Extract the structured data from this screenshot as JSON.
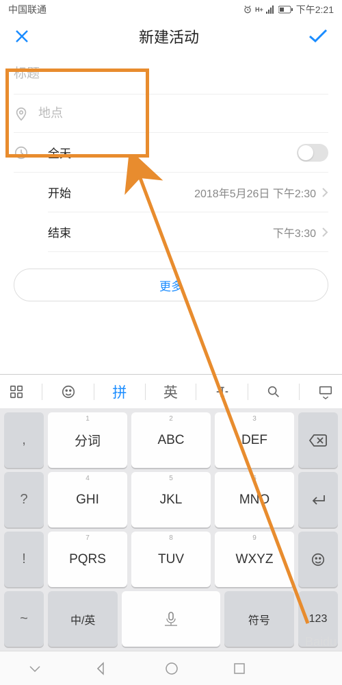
{
  "statusbar": {
    "carrier": "中国联通",
    "time": "下午2:21"
  },
  "nav": {
    "title": "新建活动"
  },
  "form": {
    "title_placeholder": "标题",
    "location_placeholder": "地点",
    "allday_label": "全天",
    "start_label": "开始",
    "start_value": "2018年5月26日 下午2:30",
    "end_label": "结束",
    "end_value": "下午3:30",
    "more_label": "更多"
  },
  "kb_toolbar": {
    "pinyin": "拼",
    "english": "英"
  },
  "keys": {
    "r1": {
      "side": ",",
      "k1n": "1",
      "k1t": "分词",
      "k2n": "2",
      "k2t": "ABC",
      "k3n": "3",
      "k3t": "DEF"
    },
    "r2": {
      "side": "?",
      "k1n": "4",
      "k1t": "GHI",
      "k2n": "5",
      "k2t": "JKL",
      "k3n": "6",
      "k3t": "MNO"
    },
    "r3": {
      "side": "!",
      "k1n": "7",
      "k1t": "PQRS",
      "k2n": "8",
      "k2t": "TUV",
      "k3n": "9",
      "k3t": "WXYZ"
    },
    "r4": {
      "side": "~",
      "k1": "中/英",
      "k3": "符号",
      "k4": "123"
    }
  },
  "watermark": "Baidu"
}
